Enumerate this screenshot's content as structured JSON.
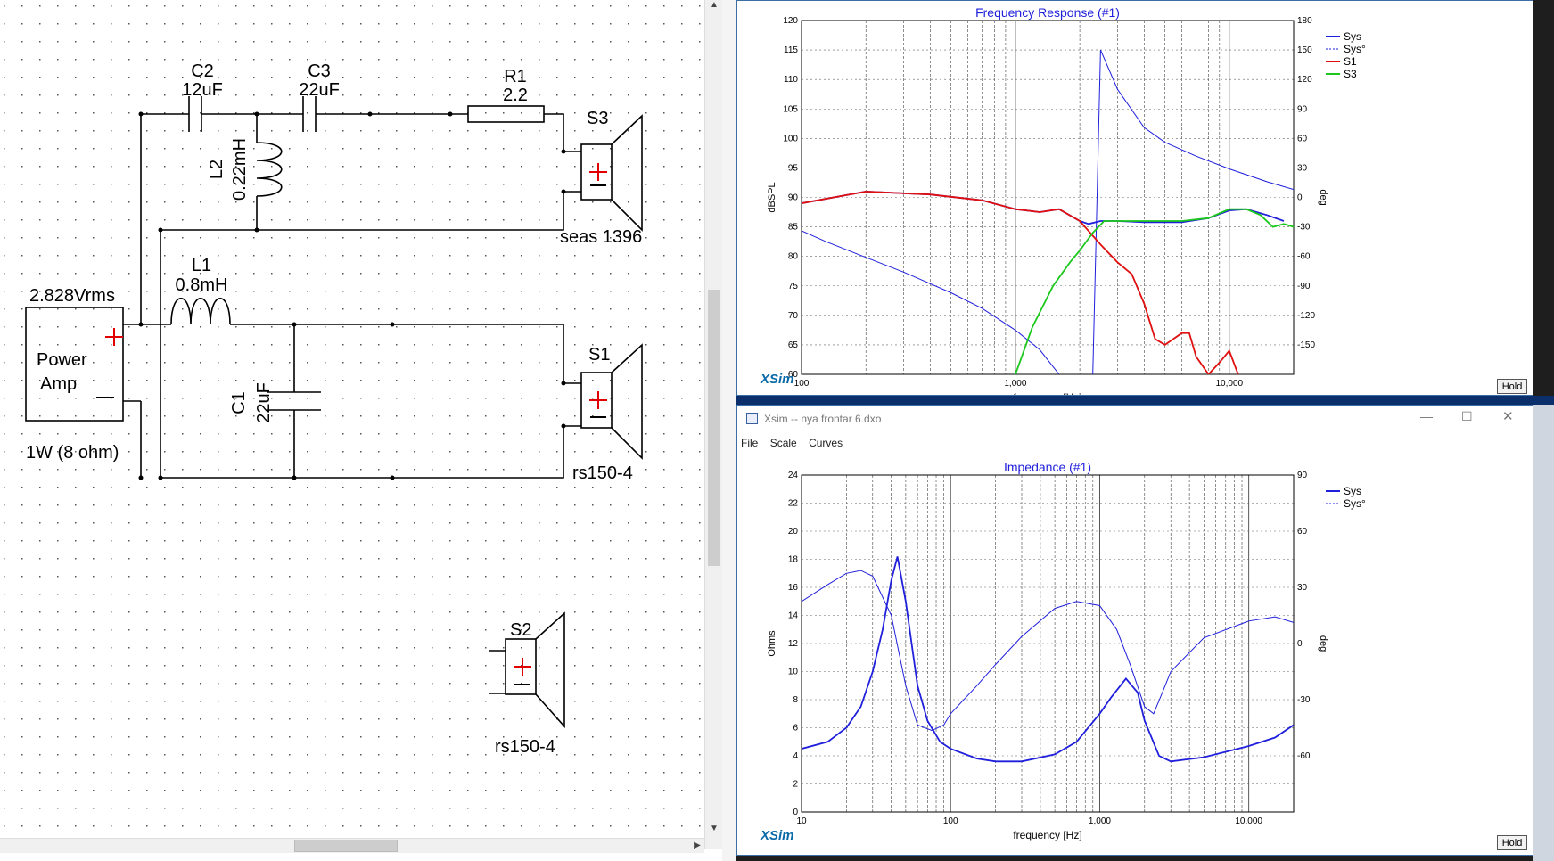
{
  "schematic": {
    "components": {
      "c2": {
        "name": "C2",
        "value": "12uF"
      },
      "c3": {
        "name": "C3",
        "value": "22uF"
      },
      "r1": {
        "name": "R1",
        "value": "2.2"
      },
      "s3": {
        "name": "S3",
        "model": "seas 1396"
      },
      "l2": {
        "name": "L2",
        "value": "0.22mH"
      },
      "l1": {
        "name": "L1",
        "value": "0.8mH"
      },
      "amp": {
        "voltage": "2.828Vrms",
        "line1": "Power",
        "line2": "Amp",
        "rating": "1W (8 ohm)"
      },
      "c1": {
        "name": "C1",
        "value": "22uF"
      },
      "s1": {
        "name": "S1",
        "model": "rs150-4"
      },
      "s2": {
        "name": "S2",
        "model": "rs150-4"
      }
    }
  },
  "freq_window": {
    "brand": "XSim",
    "hold_label": "Hold",
    "chart_data": {
      "type": "line",
      "title": "Frequency Response (#1)",
      "xlabel": "frequency [Hz]",
      "ylabel": "dBSPL",
      "y2label": "deg",
      "xscale": "log",
      "xlim": [
        100,
        20000
      ],
      "ylim": [
        60,
        120
      ],
      "y2lim": [
        -180,
        180
      ],
      "x_ticklabels": [
        "100",
        "1,000",
        "10,000"
      ],
      "y_ticks": [
        60,
        65,
        70,
        75,
        80,
        85,
        90,
        95,
        100,
        105,
        110,
        115,
        120
      ],
      "y2_ticks": [
        -150,
        -120,
        -90,
        -60,
        -30,
        0,
        30,
        60,
        90,
        120,
        150,
        180
      ],
      "legend": [
        "Sys",
        "Sys°",
        "S1",
        "S3"
      ],
      "legend_position": "top-right",
      "series": [
        {
          "name": "Sys",
          "color": "#1f1fdc",
          "axis": "left",
          "style": "solid",
          "x": [
            100,
            200,
            400,
            700,
            1000,
            1300,
            1600,
            2000,
            2200,
            2500,
            3000,
            4000,
            5000,
            6000,
            8000,
            10000,
            12000,
            15000,
            18000
          ],
          "y": [
            89,
            91,
            90.5,
            89.5,
            88,
            87.5,
            88,
            86,
            85.5,
            86,
            86,
            85.8,
            85.8,
            85.8,
            86.5,
            87.8,
            88,
            87,
            86
          ]
        },
        {
          "name": "Sys°",
          "color": "#1f1fdc",
          "axis": "right",
          "style": "dashed",
          "x": [
            100,
            130,
            200,
            300,
            500,
            700,
            1000,
            1300,
            1600,
            2000,
            2300,
            2500,
            3000,
            4000,
            5000,
            7000,
            10000,
            15000,
            20000
          ],
          "y": [
            -34,
            -45,
            -61,
            -76,
            -97,
            -113,
            -135,
            -155,
            -180,
            -210,
            -180,
            150,
            110,
            71,
            56,
            42,
            29,
            16,
            8
          ]
        },
        {
          "name": "S1",
          "color": "#e01010",
          "axis": "left",
          "style": "solid",
          "x": [
            100,
            200,
            400,
            700,
            1000,
            1300,
            1600,
            2000,
            2500,
            3000,
            3500,
            4000,
            4500,
            5000,
            6000,
            6500,
            7000,
            8000,
            9000,
            10000,
            11000
          ],
          "y": [
            89,
            91,
            90.5,
            89.5,
            88,
            87.5,
            88,
            86,
            82,
            79,
            77,
            72,
            66,
            65,
            67,
            67,
            63,
            60,
            62,
            64,
            60
          ]
        },
        {
          "name": "S3",
          "color": "#1cc81c",
          "axis": "left",
          "style": "solid",
          "x": [
            1000,
            1200,
            1500,
            1800,
            2000,
            2300,
            2600,
            3000,
            4000,
            5000,
            6000,
            8000,
            10000,
            12000,
            14000,
            16000,
            18000,
            20000
          ],
          "y": [
            60,
            68,
            75,
            79,
            81,
            84,
            86,
            86,
            86,
            86,
            86,
            86.5,
            88,
            88,
            87,
            85,
            85.5,
            85
          ]
        }
      ]
    }
  },
  "imp_window": {
    "title": "Xsim -- nya frontar 6.dxo",
    "menu": [
      "File",
      "Scale",
      "Curves"
    ],
    "brand": "XSim",
    "hold_label": "Hold",
    "chart_data": {
      "type": "line",
      "title": "Impedance (#1)",
      "xlabel": "frequency [Hz]",
      "ylabel": "Ohms",
      "y2label": "deg",
      "xscale": "log",
      "xlim": [
        10,
        20000
      ],
      "ylim": [
        0,
        24
      ],
      "y2lim": [
        -90,
        90
      ],
      "x_ticklabels": [
        "10",
        "100",
        "1,000",
        "10,000"
      ],
      "y_ticks": [
        0,
        2,
        4,
        6,
        8,
        10,
        12,
        14,
        16,
        18,
        20,
        22,
        24
      ],
      "y2_ticks": [
        -60,
        -30,
        0,
        30,
        60,
        90
      ],
      "legend": [
        "Sys",
        "Sys°"
      ],
      "legend_position": "top-right",
      "series": [
        {
          "name": "Sys",
          "color": "#1f1fdc",
          "axis": "left",
          "style": "solid",
          "x": [
            10,
            15,
            20,
            25,
            30,
            35,
            40,
            44,
            50,
            60,
            70,
            85,
            100,
            150,
            200,
            300,
            500,
            700,
            1000,
            1200,
            1500,
            1800,
            2000,
            2500,
            3000,
            5000,
            10000,
            15000,
            20000
          ],
          "y": [
            4.5,
            5,
            6,
            7.5,
            10,
            13,
            16.5,
            18.2,
            15,
            9,
            6.5,
            5,
            4.5,
            3.8,
            3.6,
            3.6,
            4.1,
            5,
            7,
            8.2,
            9.5,
            8.5,
            6.5,
            4,
            3.6,
            3.9,
            4.7,
            5.3,
            6.2
          ]
        },
        {
          "name": "Sys°",
          "color": "#1f1fdc",
          "axis": "left",
          "style": "dashed",
          "x": [
            10,
            15,
            20,
            25,
            30,
            40,
            50,
            60,
            75,
            90,
            100,
            150,
            200,
            300,
            500,
            700,
            1000,
            1300,
            1600,
            2000,
            2300,
            2700,
            3000,
            5000,
            10000,
            15000,
            20000
          ],
          "y": [
            15,
            16.2,
            17,
            17.2,
            16.8,
            14,
            9,
            6.2,
            5.8,
            6.2,
            7,
            9,
            10.5,
            12.5,
            14.5,
            15,
            14.7,
            13,
            10.5,
            7.5,
            7,
            8.8,
            10,
            12.4,
            13.6,
            13.9,
            13.5
          ]
        }
      ]
    }
  }
}
